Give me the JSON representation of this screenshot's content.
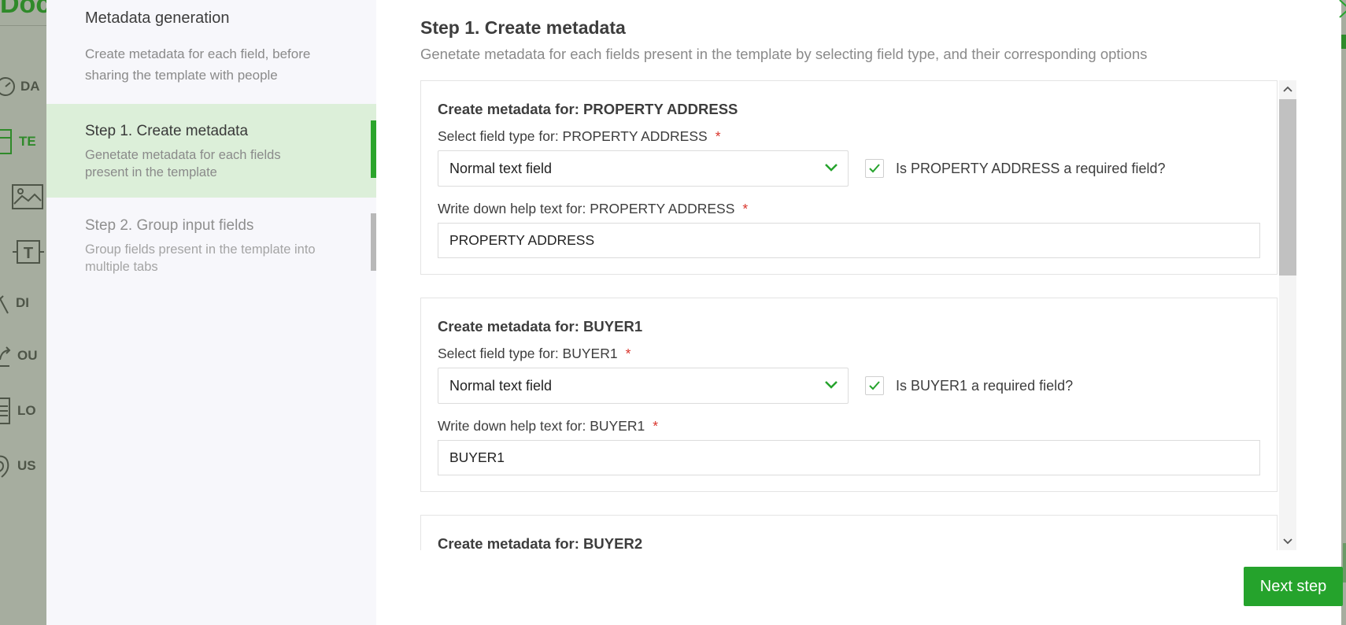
{
  "background_app": {
    "logo_text": "Doc",
    "nav_items": [
      {
        "icon": "dashboard-icon",
        "label": "DA",
        "active": false
      },
      {
        "icon": "template-icon",
        "label": "TE",
        "active": true
      },
      {
        "icon": "image-icon",
        "label": "",
        "active": false
      },
      {
        "icon": "text-field-icon",
        "label": "",
        "active": false
      },
      {
        "icon": "draw-icon",
        "label": "DI",
        "active": false
      },
      {
        "icon": "share-icon",
        "label": "OU",
        "active": false
      },
      {
        "icon": "log-icon",
        "label": "LO",
        "active": false
      },
      {
        "icon": "user-icon",
        "label": "US",
        "active": false
      }
    ]
  },
  "sidebar": {
    "title": "Metadata generation",
    "description": "Create metadata for each field, before sharing the template with people",
    "steps": [
      {
        "title": "Step 1. Create metadata",
        "description": "Genetate metadata for each fields present in the template",
        "active": true
      },
      {
        "title": "Step 2. Group input fields",
        "description": "Group fields present in the template into multiple tabs",
        "active": false
      }
    ]
  },
  "main": {
    "title": "Step 1. Create metadata",
    "subtitle": "Genetate metadata for each fields present in the template by selecting field type, and their corresponding options",
    "cards": [
      {
        "title": "Create metadata for: PROPERTY ADDRESS",
        "type_label": "Select field type for: PROPERTY ADDRESS",
        "required_mark": "*",
        "type_value": "Normal text field",
        "checkbox_label": "Is PROPERTY ADDRESS a required field?",
        "checked": true,
        "help_label": "Write down help text for: PROPERTY ADDRESS",
        "help_value": "PROPERTY ADDRESS"
      },
      {
        "title": "Create metadata for: BUYER1",
        "type_label": "Select field type for: BUYER1",
        "required_mark": "*",
        "type_value": "Normal text field",
        "checkbox_label": "Is BUYER1 a required field?",
        "checked": true,
        "help_label": "Write down help text for: BUYER1",
        "help_value": "BUYER1"
      },
      {
        "title": "Create metadata for: BUYER2"
      }
    ],
    "next_button": "Next step"
  },
  "colors": {
    "accent_green": "#25a32c",
    "active_step_bg": "#dcefd9",
    "required_red": "#d9342b"
  }
}
